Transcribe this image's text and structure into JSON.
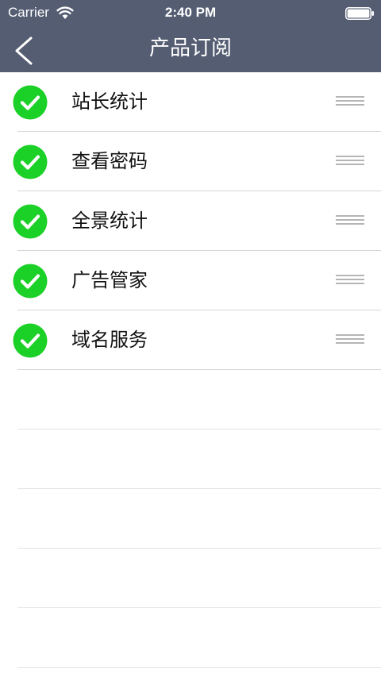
{
  "status_bar": {
    "carrier": "Carrier",
    "time": "2:40 PM",
    "wifi_icon": "wifi-icon",
    "battery_icon": "battery-icon"
  },
  "nav": {
    "title": "产品订阅",
    "back_icon": "chevron-left-icon"
  },
  "colors": {
    "header_bg": "#545d72",
    "check_green": "#1bd027",
    "separator": "#d6d6d6"
  },
  "products": [
    {
      "label": "站长统计",
      "checked": true
    },
    {
      "label": "查看密码",
      "checked": true
    },
    {
      "label": "全景统计",
      "checked": true
    },
    {
      "label": "广告管家",
      "checked": true
    },
    {
      "label": "域名服务",
      "checked": true
    }
  ]
}
